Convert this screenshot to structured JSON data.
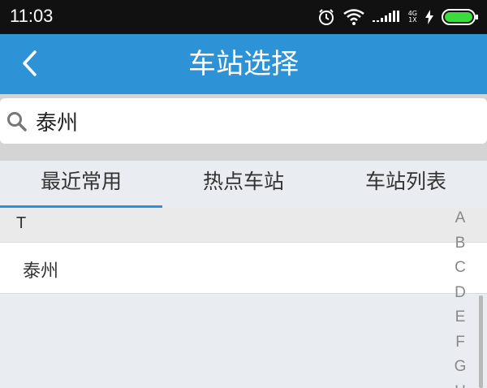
{
  "status_bar": {
    "time": "11:03",
    "network_top": "4G",
    "network_bottom": "1X"
  },
  "header": {
    "title": "车站选择"
  },
  "search": {
    "value": "泰州"
  },
  "tabs": [
    {
      "label": "最近常用",
      "active": true
    },
    {
      "label": "热点车站",
      "active": false
    },
    {
      "label": "车站列表",
      "active": false
    }
  ],
  "section": {
    "letter": "T"
  },
  "stations": [
    {
      "name": "泰州"
    }
  ],
  "alphabet": [
    "A",
    "B",
    "C",
    "D",
    "E",
    "F",
    "G",
    "H"
  ],
  "colors": {
    "accent": "#2d93d6",
    "battery": "#3cdc3c"
  }
}
